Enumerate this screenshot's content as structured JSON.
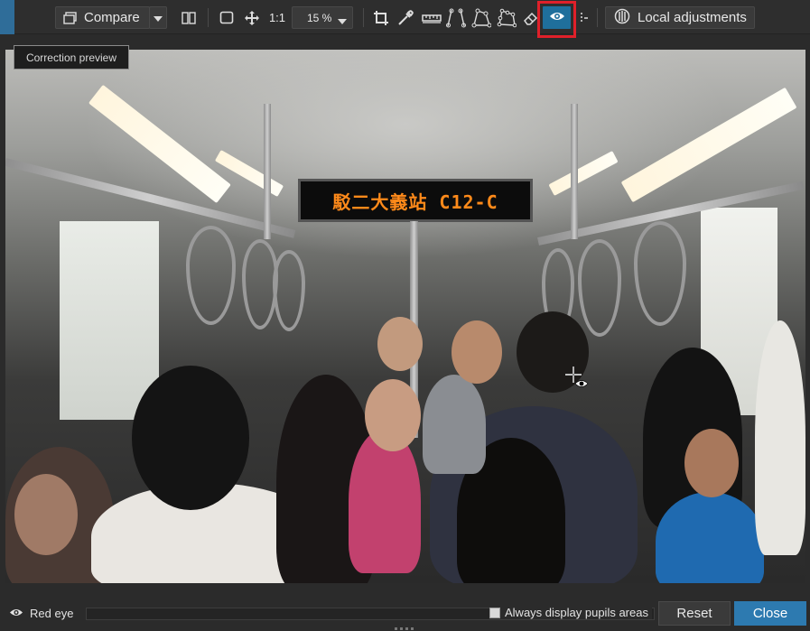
{
  "toolbar": {
    "compare_label": "Compare",
    "one_to_one_label": "1:1",
    "zoom_value": "15 %",
    "local_adjustments_label": "Local adjustments",
    "icons": [
      "compare-icon",
      "chevron-down-icon",
      "split-view-icon",
      "fit-view-icon",
      "move-icon",
      "crop-icon",
      "eyedropper-icon",
      "ruler-icon",
      "perspective-icon",
      "perspective-rect-icon",
      "perspective-8pt-icon",
      "eraser-icon",
      "eye-icon",
      "dotted-icon",
      "local-adjustments-icon"
    ],
    "active_tool": "eye-icon",
    "active_color": "#1f6f9c",
    "highlight_color": "#e0202a"
  },
  "tooltip": {
    "text": "Correction preview"
  },
  "photo": {
    "sign_text": "駁二大義站 C12-C"
  },
  "statusbar": {
    "tool_label": "Red eye",
    "always_display_label": "Always display pupils areas",
    "reset_label": "Reset",
    "close_label": "Close",
    "close_color": "#2d7ab0"
  }
}
